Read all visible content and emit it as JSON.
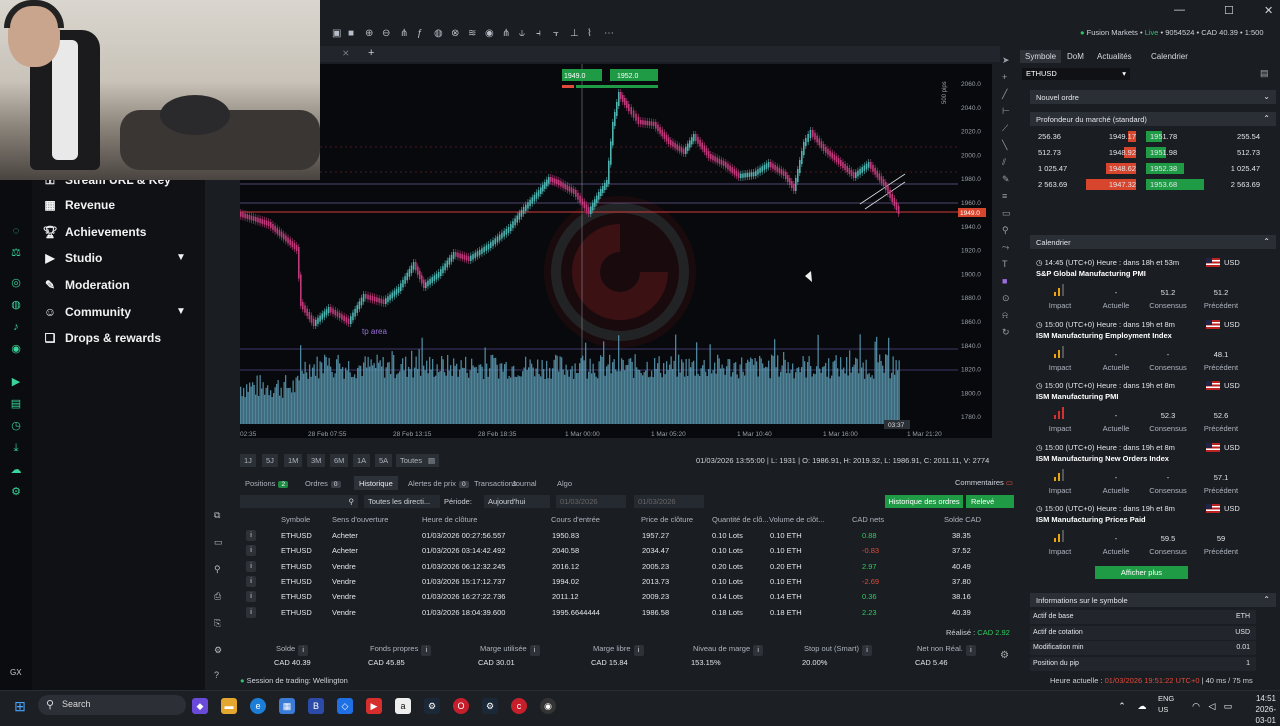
{
  "account": {
    "broker": "Fusion Markets",
    "status": "Live",
    "id": "9054524",
    "balance": "CAD 40.39",
    "leverage": "1:500"
  },
  "sidebar": {
    "items": [
      {
        "label": "Stream URL & Key",
        "icon": "key-icon"
      },
      {
        "label": "Revenue",
        "icon": "bank-icon"
      },
      {
        "label": "Achievements",
        "icon": "trophy-icon"
      },
      {
        "label": "Studio",
        "icon": "video-icon",
        "expandable": true
      },
      {
        "label": "Moderation",
        "icon": "wrench-icon"
      },
      {
        "label": "Community",
        "icon": "people-icon",
        "expandable": true
      },
      {
        "label": "Drops & rewards",
        "icon": "gift-icon"
      }
    ],
    "footer": "GX"
  },
  "chart": {
    "symbol": "ETHUSD",
    "sell_price": "1949.0",
    "buy_price": "1952.0",
    "annotation": "tp area",
    "range_label": "500 pips",
    "current_price_tag": "1949.0",
    "time_tag": "03:37",
    "price_ticks": [
      "2060.0",
      "2040.0",
      "2020.0",
      "2000.0",
      "1980.0",
      "1960.0",
      "1940.0",
      "1920.0",
      "1900.0",
      "1880.0",
      "1860.0",
      "1840.0",
      "1820.0",
      "1800.0",
      "1780.0"
    ],
    "time_ticks": [
      "02:35",
      "28 Feb 07:55",
      "28 Feb 13:15",
      "28 Feb 18:35",
      "1 Mar 00:00",
      "1 Mar 05:20",
      "1 Mar 10:40",
      "1 Mar 16:00",
      "1 Mar 21:20"
    ]
  },
  "timeframes": [
    "1J",
    "5J",
    "1M",
    "3M",
    "6M",
    "1A",
    "5A",
    "Toutes"
  ],
  "ohlc": {
    "date": "01/03/2026 13:55:00",
    "low": "L: 1931",
    "open": "O: 1986.91",
    "high": "H: 2019.32",
    "low2": "L: 1986.91",
    "close": "C: 2011.11",
    "volume": "V: 2774"
  },
  "bottom_tabs": [
    {
      "label": "Positions",
      "badge": "2"
    },
    {
      "label": "Ordres",
      "badge": "0"
    },
    {
      "label": "Historique",
      "badge": ""
    },
    {
      "label": "Alertes de prix",
      "badge": "0"
    },
    {
      "label": "Transactions",
      "badge": ""
    },
    {
      "label": "Journal",
      "badge": ""
    },
    {
      "label": "Algo",
      "badge": ""
    }
  ],
  "comments_label": "Commentaires",
  "filters": {
    "direction": "Toutes les directi...",
    "period_label": "Période:",
    "period": "Aujourd'hui",
    "from": "01/03/2026",
    "to": "01/03/2026",
    "history_btn": "Historique des ordres",
    "statement_btn": "Relevé"
  },
  "history": {
    "headers": [
      "Symbole",
      "Sens d'ouverture",
      "Heure de clôture",
      "Cours d'entrée",
      "Price de clôture",
      "Quantité de clô...",
      "Volume de clôt...",
      "CAD nets",
      "Solde CAD"
    ],
    "rows": [
      [
        "ETHUSD",
        "Acheter",
        "01/03/2026 00:27:56.557",
        "1950.83",
        "1957.27",
        "0.10 Lots",
        "0.10 ETH",
        "0.88",
        "38.35"
      ],
      [
        "ETHUSD",
        "Acheter",
        "01/03/2026 03:14:42.492",
        "2040.58",
        "2034.47",
        "0.10 Lots",
        "0.10 ETH",
        "-0.83",
        "37.52"
      ],
      [
        "ETHUSD",
        "Vendre",
        "01/03/2026 06:12:32.245",
        "2016.12",
        "2005.23",
        "0.20 Lots",
        "0.20 ETH",
        "2.97",
        "40.49"
      ],
      [
        "ETHUSD",
        "Vendre",
        "01/03/2026 15:17:12.737",
        "1994.02",
        "2013.73",
        "0.10 Lots",
        "0.10 ETH",
        "-2.69",
        "37.80"
      ],
      [
        "ETHUSD",
        "Vendre",
        "01/03/2026 16:27:22.736",
        "2011.12",
        "2009.23",
        "0.14 Lots",
        "0.14 ETH",
        "0.36",
        "38.16"
      ],
      [
        "ETHUSD",
        "Vendre",
        "01/03/2026 18:04:39.600",
        "1995.6644444",
        "1986.58",
        "0.18 Lots",
        "0.18 ETH",
        "2.23",
        "40.39"
      ]
    ],
    "realised_label": "Réalisé :",
    "realised": "CAD 2.92"
  },
  "summary": [
    {
      "label": "Solde",
      "value": "CAD 40.39"
    },
    {
      "label": "Fonds propres",
      "value": "CAD 45.85"
    },
    {
      "label": "Marge utilisée",
      "value": "CAD 30.01"
    },
    {
      "label": "Marge libre",
      "value": "CAD 15.84"
    },
    {
      "label": "Niveau de marge",
      "value": "153.15%"
    },
    {
      "label": "Stop out (Smart)",
      "value": "20.00%"
    },
    {
      "label": "Net non Réal.",
      "value": "CAD 5.46"
    }
  ],
  "session": "Session de trading: Wellington",
  "statusbar": {
    "label": "Heure actuelle :",
    "time": "01/03/2026 19:51:22",
    "tz": "UTC+0",
    "latency": "40 ms / 75 ms"
  },
  "right_panel": {
    "tabs": [
      "Symbole",
      "DoM",
      "Actualités",
      "Calendrier"
    ],
    "symbol": "ETHUSD",
    "new_order": "Nouvel ordre",
    "depth_title": "Profondeur du marché (standard)",
    "depth": [
      [
        "256.36",
        "1949.17",
        "1951.78",
        "255.54"
      ],
      [
        "512.73",
        "1948.92",
        "1951.98",
        "512.73"
      ],
      [
        "1 025.47",
        "1948.62",
        "1952.38",
        "1 025.47"
      ],
      [
        "2 563.69",
        "1947.32",
        "1953.68",
        "2 563.69"
      ]
    ],
    "calendar_title": "Calendrier",
    "events": [
      {
        "time": "14:45 (UTC+0) Heure : dans 18h et 53m",
        "name": "S&P Global Manufacturing PMI",
        "currency": "USD",
        "actual": "-",
        "consensus": "51.2",
        "previous": "51.2"
      },
      {
        "time": "15:00 (UTC+0) Heure : dans 19h et 8m",
        "name": "ISM Manufacturing Employment Index",
        "currency": "USD",
        "actual": "-",
        "consensus": "-",
        "previous": "48.1"
      },
      {
        "time": "15:00 (UTC+0) Heure : dans 19h et 8m",
        "name": "ISM Manufacturing PMI",
        "currency": "USD",
        "actual": "-",
        "consensus": "52.3",
        "previous": "52.6"
      },
      {
        "time": "15:00 (UTC+0) Heure : dans 19h et 8m",
        "name": "ISM Manufacturing New Orders Index",
        "currency": "USD",
        "actual": "-",
        "consensus": "-",
        "previous": "57.1"
      },
      {
        "time": "15:00 (UTC+0) Heure : dans 19h et 8m",
        "name": "ISM Manufacturing Prices Paid",
        "currency": "USD",
        "actual": "-",
        "consensus": "59.5",
        "previous": "59"
      }
    ],
    "cal_labels": {
      "impact": "Impact",
      "actual": "Actuelle",
      "consensus": "Consensus",
      "previous": "Précédent"
    },
    "more_btn": "Afficher plus",
    "info_title": "Informations sur le symbole",
    "info": [
      {
        "label": "Actif de base",
        "value": "ETH"
      },
      {
        "label": "Actif de cotation",
        "value": "USD"
      },
      {
        "label": "Modification min",
        "value": "0.01"
      },
      {
        "label": "Position du pip",
        "value": "1"
      }
    ]
  },
  "taskbar": {
    "search": "Search",
    "lang1": "ENG",
    "lang2": "US",
    "time": "14:51",
    "date": "2026-03-01"
  },
  "colors": {
    "accent_green": "#1f9b46",
    "sell_red": "#e24a3a",
    "buy_green": "#2ecc5c",
    "bull_candle": "#4fb3b0",
    "bear_candle": "#c0397a",
    "volume": "#5a9bb5"
  }
}
